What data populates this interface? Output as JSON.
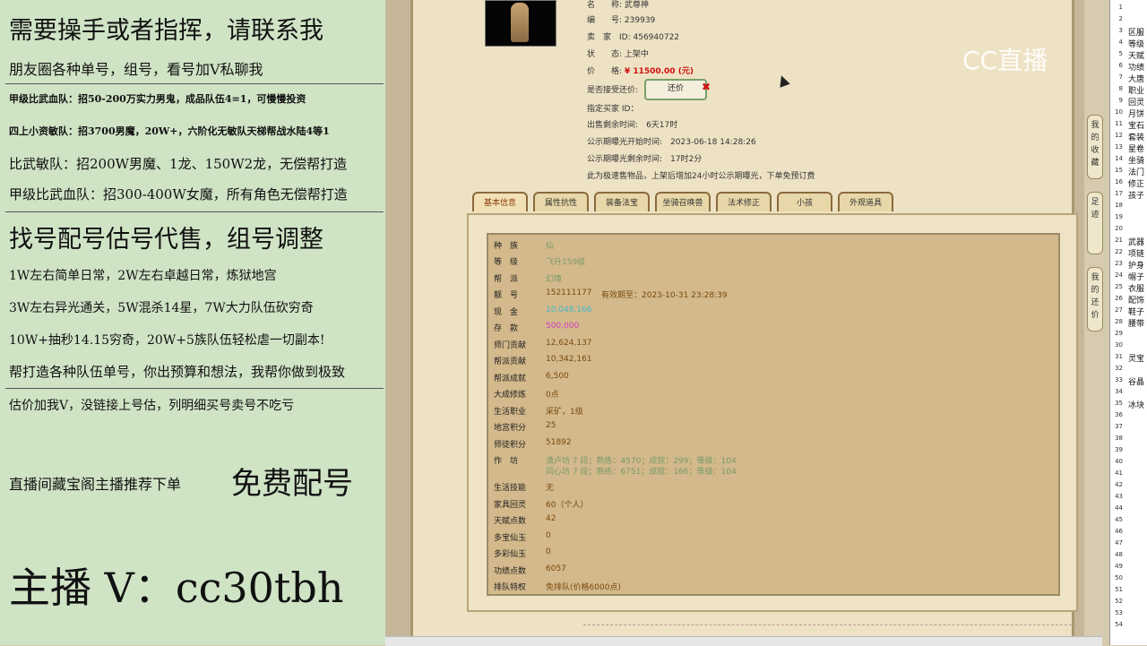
{
  "promo": {
    "lines": [
      "需要操手或者指挥，请联系我",
      "朋友圈各种单号，组号，看号加V私聊我",
      "甲级比武血队：招50-200万实力男鬼，成品队伍4=1，可慢慢投资",
      "四上小资敏队：招3700男魔，20W+，六阶化无敏队天梯帮战水陆4等1",
      "比武敏队：招200W男魔、1龙、150W2龙，无偿帮打造",
      "甲级比武血队：招300-400W女魔，所有角色无偿帮打造",
      "找号配号估号代售，组号调整",
      "1W左右简单日常，2W左右卓越日常，炼狱地宫",
      "3W左右异光通关，5W混杀14星，7W大力队伍砍穷奇",
      "10W+抽秒14.15穷奇，20W+5族队伍轻松虐一切副本!",
      "帮打造各种队伍单号，你出预算和想法，我帮你做到极致",
      "估价加我V，没链接上号估，列明细买号卖号不吃亏",
      "直播间藏宝阁主播推荐下单",
      "免费配号",
      "主播 V：cc30tbh"
    ]
  },
  "listing": {
    "name_label": "名　　称:",
    "name_value": "武尊神",
    "id_label": "编　　号:",
    "id_value": "239939",
    "seller_label": "卖　家　ID:",
    "seller_value": "456940722",
    "status_label": "状　　态:",
    "status_value": "上架中",
    "price_label": "价　　格:",
    "price_value": "¥ 11500.00 (元)",
    "counter_label": "是否接受还价:",
    "counter_button": "还价",
    "buyer_label": "指定买家 ID：",
    "remain_label": "出售剩余时间:",
    "remain_value": "6天17时",
    "pub_start_label": "公示期曝光开始时间:",
    "pub_start_value": "2023-06-18 14:28:26",
    "pub_remain_label": "公示期曝光剩余时间:",
    "pub_remain_value": "17时2分",
    "note": "此为极速售物品，上架后增加24小时公示期曝光，下单免预订费"
  },
  "tabs": [
    "基本信息",
    "属性抗性",
    "装备法宝",
    "坐骑召唤兽",
    "法术修正",
    "小孩",
    "外观道具"
  ],
  "rows": [
    {
      "label": "种　族",
      "value": "仙",
      "extra": ""
    },
    {
      "label": "等　级",
      "value": "飞升159级",
      "extra": ""
    },
    {
      "label": "帮　派",
      "value": "幻境",
      "extra": ""
    },
    {
      "label": "靓　号",
      "value": "152111177",
      "extra": "有效期至：2023-10-31 23:28:39"
    },
    {
      "label": "现　金",
      "value": "10,048,166",
      "extra": ""
    },
    {
      "label": "存　款",
      "value": "500,000",
      "extra": ""
    },
    {
      "label": "师门贡献",
      "value": "12,624,137",
      "extra": ""
    },
    {
      "label": "帮派贡献",
      "value": "10,342,161",
      "extra": ""
    },
    {
      "label": "帮派成就",
      "value": "6,500",
      "extra": ""
    },
    {
      "label": "大成修炼",
      "value": "0点",
      "extra": ""
    },
    {
      "label": "生活职业",
      "value": "采矿，1级",
      "extra": ""
    },
    {
      "label": "地宫积分",
      "value": "25",
      "extra": ""
    },
    {
      "label": "师徒积分",
      "value": "51892",
      "extra": ""
    },
    {
      "label": "作　坊",
      "value": "潇卢坊 7 段；熟练：4570；成就：299；等级：104",
      "extra": "同心坊 7 段；熟练：6751；成就：166；等级：104"
    },
    {
      "label": "生活技能",
      "value": "无",
      "extra": ""
    },
    {
      "label": "家具回灵",
      "value": "60（个人）",
      "extra": ""
    },
    {
      "label": "天赋点数",
      "value": "42",
      "extra": ""
    },
    {
      "label": "多宝仙玉",
      "value": "0",
      "extra": ""
    },
    {
      "label": "多彩仙玉",
      "value": "0",
      "extra": ""
    },
    {
      "label": "功绩点数",
      "value": "6057",
      "extra": ""
    },
    {
      "label": "排队特权",
      "value": "免排队(价格6000点)",
      "extra": ""
    }
  ],
  "side_buttons": [
    "我的收藏",
    "足迹",
    "我的还价"
  ],
  "logo": "CC直播",
  "sheet": {
    "row_numbers": [
      "1",
      "2",
      "3",
      "4",
      "5",
      "6",
      "7",
      "8",
      "9",
      "10",
      "11",
      "12",
      "13",
      "14",
      "15",
      "16",
      "17",
      "18",
      "19",
      "20",
      "21",
      "22",
      "23",
      "24",
      "25",
      "26",
      "27",
      "28",
      "29",
      "30",
      "31",
      "32",
      "33",
      "34",
      "35",
      "36",
      "37",
      "38",
      "39",
      "40",
      "41",
      "42",
      "43",
      "44",
      "45",
      "46",
      "47",
      "48",
      "49",
      "50",
      "51",
      "52",
      "53",
      "54"
    ],
    "cells": [
      "区服",
      "等级",
      "天赋",
      "功绩",
      "大唐",
      "职业",
      "回灵",
      "月饼",
      "宝石",
      "套装",
      "星卷",
      "坐骑",
      "法门",
      "修正",
      "孩子",
      "",
      "",
      "",
      "武器",
      "项链",
      "护身",
      "帽子",
      "衣服",
      "配饰",
      "鞋子",
      "腰带",
      "",
      "",
      "灵宝",
      "",
      "谷晶",
      "",
      "冰块"
    ]
  }
}
